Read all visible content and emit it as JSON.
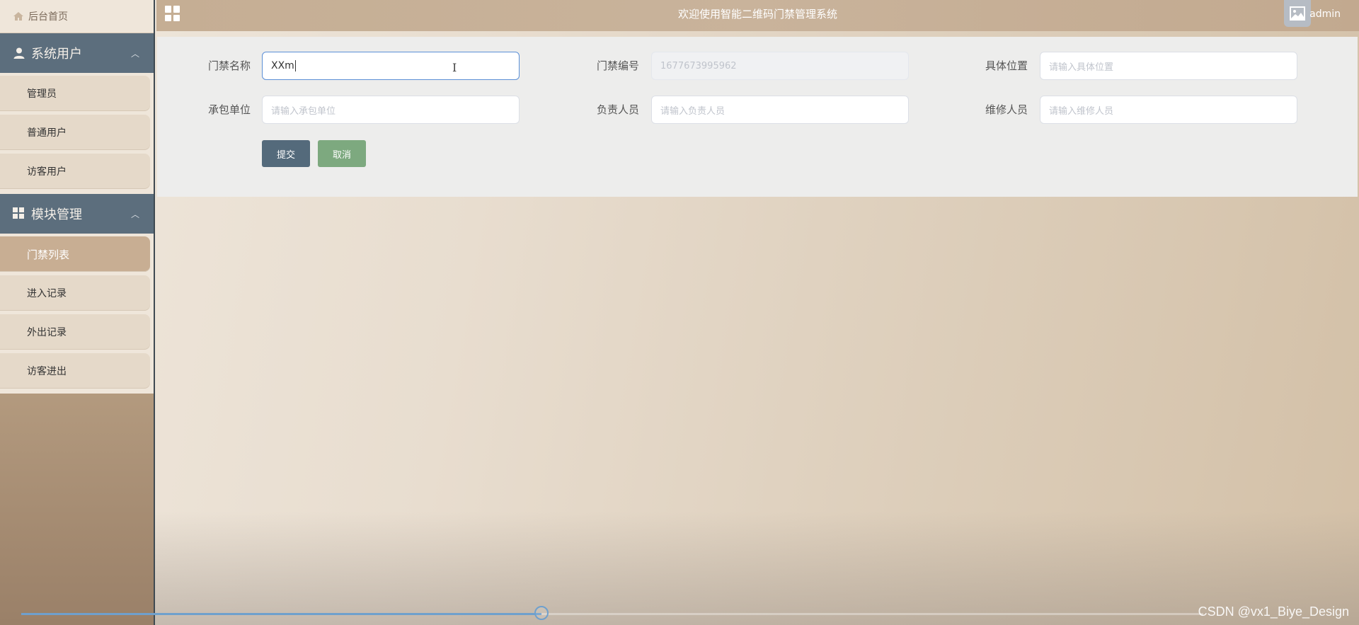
{
  "sidebar": {
    "home_label": "后台首页",
    "groups": [
      {
        "title": "系统用户",
        "icon": "user-icon",
        "items": [
          {
            "label": "管理员"
          },
          {
            "label": "普通用户"
          },
          {
            "label": "访客用户"
          }
        ]
      },
      {
        "title": "模块管理",
        "icon": "grid-icon",
        "items": [
          {
            "label": "门禁列表",
            "active": true
          },
          {
            "label": "进入记录"
          },
          {
            "label": "外出记录"
          },
          {
            "label": "访客进出"
          }
        ]
      }
    ]
  },
  "topbar": {
    "title": "欢迎使用智能二维码门禁管理系统",
    "username": "admin"
  },
  "form": {
    "name_label": "门禁名称",
    "name_value": "XXm",
    "code_label": "门禁编号",
    "code_value": "1677673995962",
    "location_label": "具体位置",
    "location_placeholder": "请输入具体位置",
    "contractor_label": "承包单位",
    "contractor_placeholder": "请输入承包单位",
    "manager_label": "负责人员",
    "manager_placeholder": "请输入负责人员",
    "repair_label": "维修人员",
    "repair_placeholder": "请输入维修人员",
    "submit_label": "提交",
    "cancel_label": "取消"
  },
  "video": {
    "progress": 0.44
  },
  "watermark": "CSDN @vx1_Biye_Design",
  "colors": {
    "sidebar_header": "#5c6e7d",
    "submit_button": "#546a7b",
    "cancel_button": "#7da97f",
    "input_focus_border": "#5b8fd6"
  }
}
